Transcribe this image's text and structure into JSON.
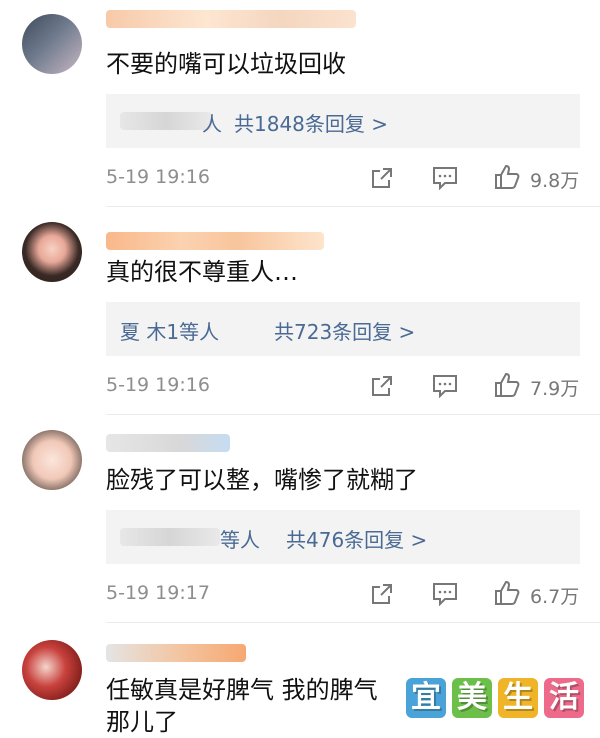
{
  "comments": [
    {
      "text": "不要的嘴可以垃圾回收",
      "reply_prefix": "人",
      "reply_count": "共1848条回复 >",
      "time": "5-19 19:16",
      "likes": "9.8万"
    },
    {
      "text": "真的很不尊重人…",
      "reply_prefix": "夏 木1等人",
      "reply_count": "共723条回复 >",
      "time": "5-19 19:16",
      "likes": "7.9万"
    },
    {
      "text": "脸残了可以整，嘴惨了就糊了",
      "reply_prefix": "等人",
      "reply_count": "共476条回复 >",
      "time": "5-19 19:17",
      "likes": "6.7万"
    },
    {
      "text_line1": "任敏真是好脾气 我的脾气",
      "text_line2": "那儿了"
    }
  ],
  "watermark": [
    "宜",
    "美",
    "生",
    "活"
  ],
  "colors": {
    "link": "#4a6a94",
    "meta": "#8e8e8e",
    "reply_bg": "#f3f3f3",
    "watermark": [
      "#4aa3d8",
      "#6cc04a",
      "#f0b428",
      "#ee6a8a"
    ]
  }
}
